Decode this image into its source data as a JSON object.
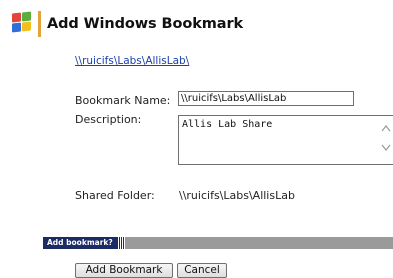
{
  "header": {
    "title": "Add Windows Bookmark",
    "logo_icon": "windows-logo-icon",
    "accent_color": "#e4a23a"
  },
  "path_link": "\\\\ruicifs\\Labs\\AllisLab\\",
  "form": {
    "bookmark_name_label": "Bookmark Name:",
    "bookmark_name_value": "\\\\ruicifs\\Labs\\AllisLab",
    "description_label": "Description:",
    "description_value": "Allis Lab Share",
    "shared_folder_label": "Shared Folder:",
    "shared_folder_value": "\\\\ruicifs\\Labs\\AllisLab"
  },
  "status_bar": {
    "label": "Add bookmark?",
    "label_color": "#1c2a66",
    "fill_color": "#9a9a9a"
  },
  "buttons": {
    "add_label": "Add Bookmark",
    "cancel_label": "Cancel"
  }
}
